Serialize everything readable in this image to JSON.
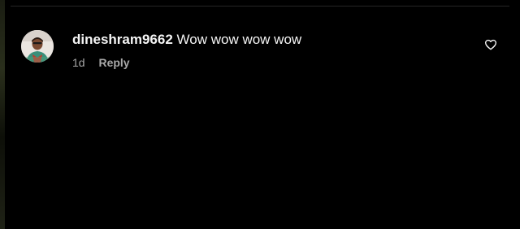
{
  "comment": {
    "username": "dineshram9662",
    "text": "Wow wow wow wow",
    "timestamp": "1d",
    "reply_label": "Reply",
    "like_icon": "heart-outline-icon"
  },
  "colors": {
    "background": "#000000",
    "primary_text": "#f5f5f5",
    "secondary_text": "#a8a8a8",
    "divider": "#262626"
  }
}
